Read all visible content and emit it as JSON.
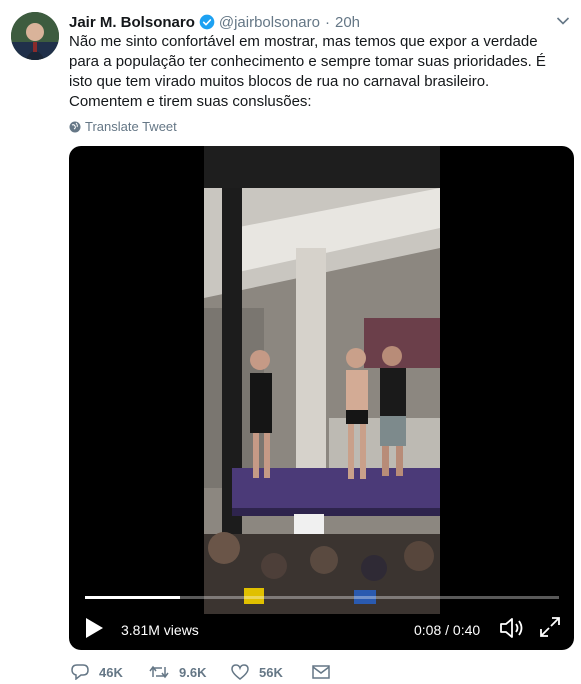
{
  "tweet": {
    "author_name": "Jair M. Bolsonaro",
    "handle": "@jairbolsonaro",
    "separator": "·",
    "time": "20h",
    "text": "Não me sinto confortável em mostrar, mas temos que expor a verdade para a população ter conhecimento e sempre tomar suas prioridades. É isto que tem virado muitos blocos de rua no carnaval brasileiro. Comentem e tirem suas conslusões:",
    "translate_label": "Translate Tweet"
  },
  "video": {
    "views": "3.81M views",
    "time": "0:08 / 0:40",
    "progress": 0.2
  },
  "actions": {
    "replies": "46K",
    "retweets": "9.6K",
    "likes": "56K"
  },
  "icons": [
    "verified-icon",
    "chevron-down-icon",
    "globe-icon",
    "play-icon",
    "volume-icon",
    "fullscreen-icon",
    "reply-icon",
    "retweet-icon",
    "like-icon",
    "message-icon"
  ],
  "colors": {
    "accent": "#1da1f2",
    "muted": "#657786",
    "video_bg": "#000000"
  }
}
